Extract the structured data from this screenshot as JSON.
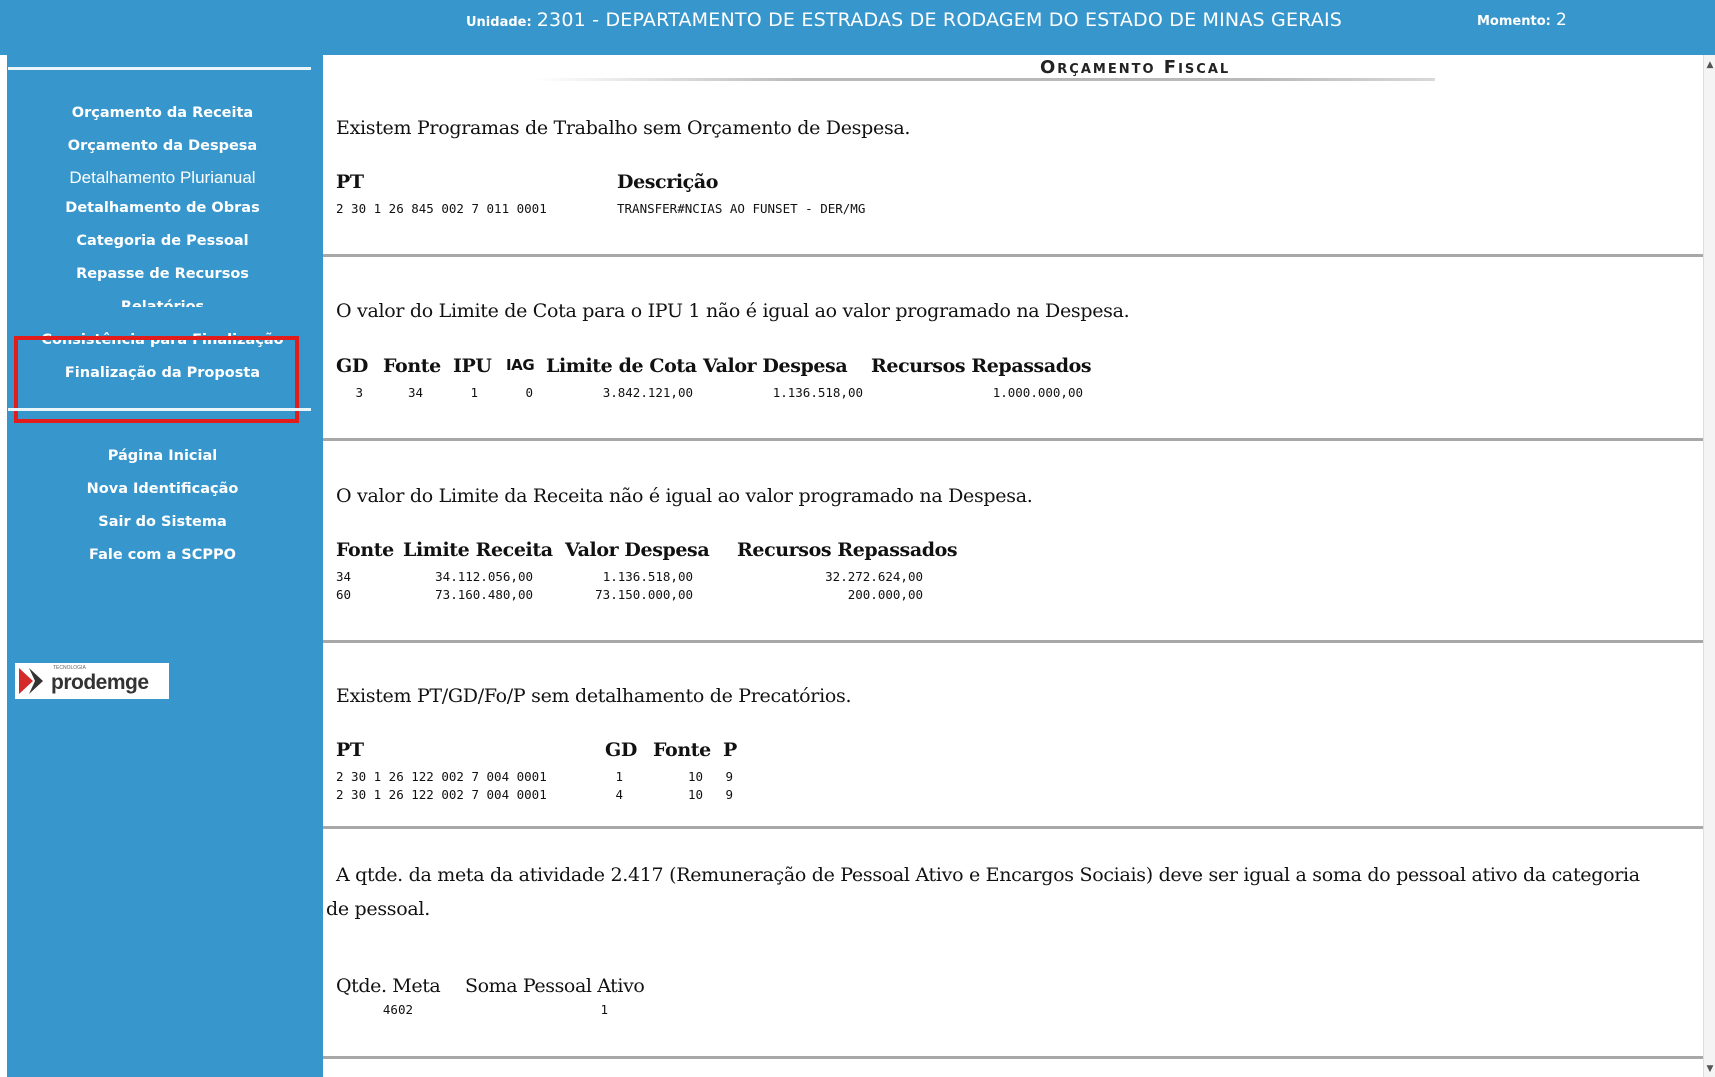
{
  "header": {
    "unit_label": "Unidade:",
    "unit_value": "2301 - DEPARTAMENTO DE ESTRADAS DE RODAGEM DO ESTADO DE MINAS GERAIS",
    "moment_label": "Momento:",
    "moment_value": "2"
  },
  "sidebar": {
    "items": [
      {
        "label": "Orçamento da Receita"
      },
      {
        "label": "Orçamento da Despesa"
      },
      {
        "label": "Detalhamento Plurianual"
      },
      {
        "label": "Detalhamento de Obras"
      },
      {
        "label": "Categoria de Pessoal"
      },
      {
        "label": "Repasse de Recursos"
      },
      {
        "label": "Relatórios"
      },
      {
        "label": "Consistência para Finalização"
      },
      {
        "label": "Finalização da Proposta"
      }
    ],
    "secondary": [
      {
        "label": "Página Inicial"
      },
      {
        "label": "Nova Identificação"
      },
      {
        "label": "Sair do Sistema"
      },
      {
        "label": "Fale com a SCPPO"
      }
    ],
    "logo": {
      "small_text": "TECNOLOGIA",
      "text": "prodemge"
    }
  },
  "main": {
    "title": "Orçamento Fiscal",
    "sections": [
      {
        "message": "Existem Programas de Trabalho sem Orçamento de Despesa.",
        "headers": [
          "PT",
          "Descrição"
        ],
        "rows": [
          [
            "2 30 1 26 845 002 7 011 0001",
            "TRANSFER#NCIAS AO FUNSET - DER/MG"
          ]
        ]
      },
      {
        "message": "O valor do Limite de Cota para o IPU 1 não é igual ao valor programado na Despesa.",
        "headers": [
          "GD",
          "Fonte",
          "IPU",
          "IAG",
          "Limite de Cota",
          "Valor Despesa",
          "Recursos Repassados"
        ],
        "rows": [
          [
            "3",
            "34",
            "1",
            "0",
            "3.842.121,00",
            "1.136.518,00",
            "1.000.000,00"
          ]
        ]
      },
      {
        "message": "O valor do Limite da Receita não é igual ao valor programado na Despesa.",
        "headers": [
          "Fonte",
          "Limite Receita",
          "Valor Despesa",
          "Recursos Repassados"
        ],
        "rows": [
          [
            "34",
            "34.112.056,00",
            "1.136.518,00",
            "32.272.624,00"
          ],
          [
            "60",
            "73.160.480,00",
            "73.150.000,00",
            "200.000,00"
          ]
        ]
      },
      {
        "message": "Existem PT/GD/Fo/P sem detalhamento de Precatórios.",
        "headers": [
          "PT",
          "GD",
          "Fonte",
          "P"
        ],
        "rows": [
          [
            "2 30 1 26 122 002 7 004 0001",
            "1",
            "10",
            "9"
          ],
          [
            "2 30 1 26 122 002 7 004 0001",
            "4",
            "10",
            "9"
          ]
        ]
      },
      {
        "message": "A qtde. da meta da atividade 2.417 (Remuneração de Pessoal Ativo e Encargos Sociais) deve ser igual a soma do pessoal ativo da categoria de pessoal.",
        "headers": [
          "Qtde. Meta",
          "Soma Pessoal Ativo"
        ],
        "rows": [
          [
            "4602",
            "1"
          ]
        ]
      }
    ]
  },
  "colors": {
    "sidebar_bg": "#3797cd",
    "highlight_border": "#e21b1b",
    "text": "#111111"
  }
}
